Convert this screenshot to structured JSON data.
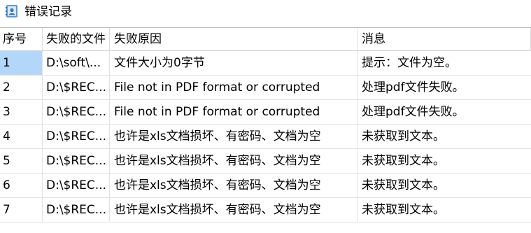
{
  "window": {
    "title": "错误记录",
    "icon": "user-contact-icon"
  },
  "table": {
    "columns": [
      "序号",
      "失败的文件",
      "失败原因",
      "消息"
    ],
    "rows": [
      {
        "index": "1",
        "file": "D:\\soft\\...",
        "reason": "文件大小为0字节",
        "message": "提示：文件为空。",
        "selected": true
      },
      {
        "index": "2",
        "file": "D:\\$REC...",
        "reason": "File not in PDF format or corrupted",
        "message": "处理pdf文件失败。"
      },
      {
        "index": "3",
        "file": "D:\\$REC...",
        "reason": "File not in PDF format or corrupted",
        "message": "处理pdf文件失败。"
      },
      {
        "index": "4",
        "file": "D:\\$REC...",
        "reason": "也许是xls文档损坏、有密码、文档为空",
        "message": "未获取到文本。"
      },
      {
        "index": "5",
        "file": "D:\\$REC...",
        "reason": "也许是xls文档损坏、有密码、文档为空",
        "message": "未获取到文本。"
      },
      {
        "index": "6",
        "file": "D:\\$REC...",
        "reason": "也许是xls文档损坏、有密码、文档为空",
        "message": "未获取到文本。"
      },
      {
        "index": "7",
        "file": "D:\\$REC...",
        "reason": "也许是xls文档损坏、有密码、文档为空",
        "message": "未获取到文本。"
      }
    ]
  },
  "colors": {
    "selection": "#b2d7f9",
    "gridline": "#e2e2e2",
    "icon_primary": "#4a90d9"
  }
}
